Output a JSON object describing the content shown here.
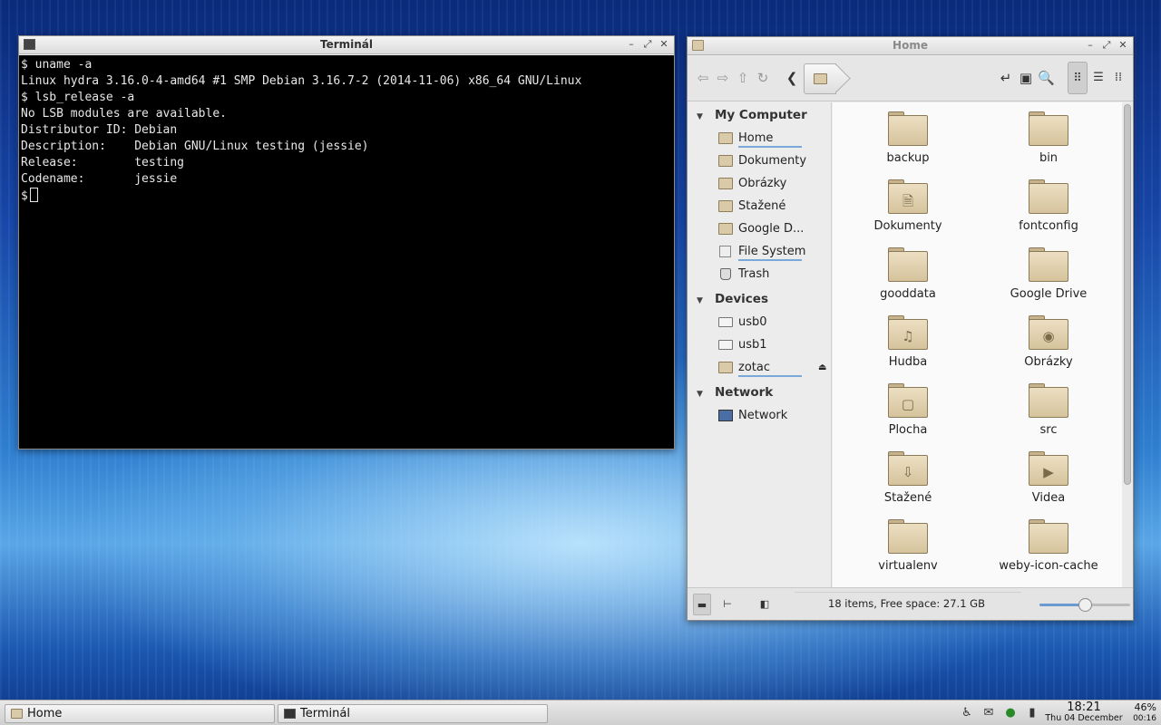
{
  "terminal": {
    "title": "Terminál",
    "lines": [
      "$ uname -a",
      "Linux hydra 3.16.0-4-amd64 #1 SMP Debian 3.16.7-2 (2014-11-06) x86_64 GNU/Linux",
      "$ lsb_release -a",
      "No LSB modules are available.",
      "Distributor ID: Debian",
      "Description:    Debian GNU/Linux testing (jessie)",
      "Release:        testing",
      "Codename:       jessie"
    ],
    "prompt": "$"
  },
  "filemanager": {
    "title": "Home",
    "sidebar": {
      "sections": [
        {
          "header": "My Computer",
          "items": [
            {
              "label": "Home",
              "icon": "home-folder-icon"
            },
            {
              "label": "Dokumenty",
              "icon": "documents-folder-icon"
            },
            {
              "label": "Obrázky",
              "icon": "pictures-folder-icon"
            },
            {
              "label": "Stažené",
              "icon": "downloads-folder-icon"
            },
            {
              "label": "Google D...",
              "icon": "folder-icon"
            },
            {
              "label": "File System",
              "icon": "filesystem-icon"
            },
            {
              "label": "Trash",
              "icon": "trash-icon"
            }
          ]
        },
        {
          "header": "Devices",
          "items": [
            {
              "label": "usb0",
              "icon": "drive-icon"
            },
            {
              "label": "usb1",
              "icon": "drive-icon"
            },
            {
              "label": "zotac",
              "icon": "folder-icon"
            }
          ]
        },
        {
          "header": "Network",
          "items": [
            {
              "label": "Network",
              "icon": "network-icon"
            }
          ]
        }
      ]
    },
    "files": [
      {
        "name": "backup",
        "emblem": ""
      },
      {
        "name": "bin",
        "emblem": ""
      },
      {
        "name": "Dokumenty",
        "emblem": "document"
      },
      {
        "name": "fontconfig",
        "emblem": ""
      },
      {
        "name": "gooddata",
        "emblem": ""
      },
      {
        "name": "Google Drive",
        "emblem": ""
      },
      {
        "name": "Hudba",
        "emblem": "music"
      },
      {
        "name": "Obrázky",
        "emblem": "camera"
      },
      {
        "name": "Plocha",
        "emblem": "desktop"
      },
      {
        "name": "src",
        "emblem": ""
      },
      {
        "name": "Stažené",
        "emblem": "download"
      },
      {
        "name": "Videa",
        "emblem": "video"
      },
      {
        "name": "virtualenv",
        "emblem": ""
      },
      {
        "name": "weby-icon-cache",
        "emblem": ""
      }
    ],
    "status": "18 items, Free space: 27.1 GB",
    "zoom_fraction": 0.5
  },
  "taskbar": {
    "tasks": [
      {
        "label": "Home",
        "icon": "folder-icon"
      },
      {
        "label": "Terminál",
        "icon": "terminal-icon"
      }
    ],
    "clock_time": "18:21",
    "clock_date": "Thu 04 December",
    "battery_percent": "46%",
    "battery_remaining": "00:16"
  }
}
